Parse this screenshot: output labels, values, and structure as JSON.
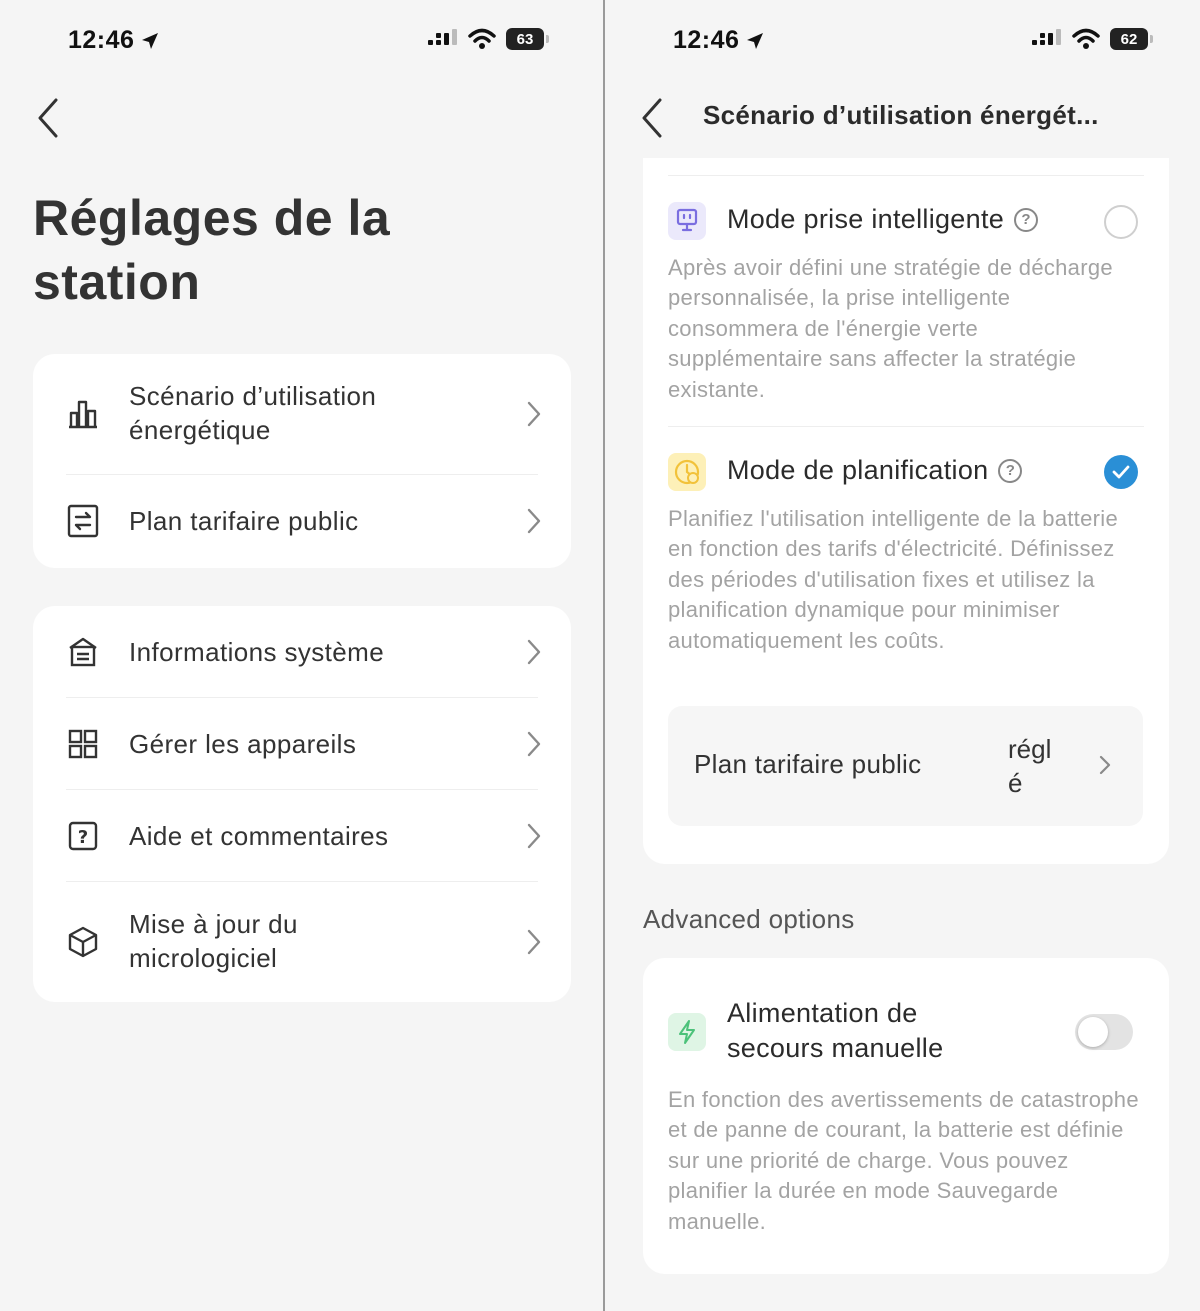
{
  "colors": {
    "background": "#f5f5f5",
    "card": "#ffffff",
    "text": "#2b2b2b",
    "muted": "#a3a3a3",
    "accent_blue": "#2a8fd6",
    "smart_plug_bg": "#ebe9fb",
    "schedule_bg": "#fdf0b8",
    "backup_bg": "#dff5e5"
  },
  "left": {
    "status": {
      "time": "12:46",
      "battery": "63"
    },
    "back_icon": "chevron-left-icon",
    "title_line1": "Réglages de la",
    "title_line2": "station",
    "group1": [
      {
        "icon": "bar-chart-icon",
        "label_line1": "Scénario d’utilisation",
        "label_line2": "énergétique"
      },
      {
        "icon": "tariff-exchange-icon",
        "label": "Plan tarifaire public"
      }
    ],
    "group2": [
      {
        "icon": "home-info-icon",
        "label": "Informations système"
      },
      {
        "icon": "grid-icon",
        "label": "Gérer les appareils"
      },
      {
        "icon": "help-box-icon",
        "label": "Aide et commentaires"
      },
      {
        "icon": "cube-icon",
        "label_line1": "Mise à jour du",
        "label_line2": "micrologiciel"
      }
    ]
  },
  "right": {
    "status": {
      "time": "12:46",
      "battery": "62"
    },
    "header_title": "Scénario d’utilisation énergét...",
    "smart_plug": {
      "icon": "smart-plug-icon",
      "title": "Mode prise intelligente",
      "selected": false,
      "description": "Après avoir défini une stratégie de décharge personnalisée, la prise intelligente consommera de l'énergie verte supplémentaire sans affecter la stratégie existante."
    },
    "schedule": {
      "icon": "clock-icon",
      "title": "Mode de planification",
      "selected": true,
      "description": "Planifiez l'utilisation intelligente de la batterie en fonction des tarifs d'électricité. Définissez des périodes d'utilisation fixes et utilisez la planification dynamique pour minimiser automatiquement les coûts.",
      "tariff_label": "Plan tarifaire public",
      "tariff_status_line1": "régl",
      "tariff_status_line2": "é"
    },
    "advanced": {
      "section_title": "Advanced options",
      "backup": {
        "icon": "lightning-icon",
        "title_line1": "Alimentation de",
        "title_line2": "secours manuelle",
        "enabled": false,
        "description": "En fonction des avertissements de catastrophe et de panne de courant, la batterie est définie sur une priorité de charge. Vous pouvez planifier la durée en mode Sauvegarde manuelle."
      }
    }
  }
}
